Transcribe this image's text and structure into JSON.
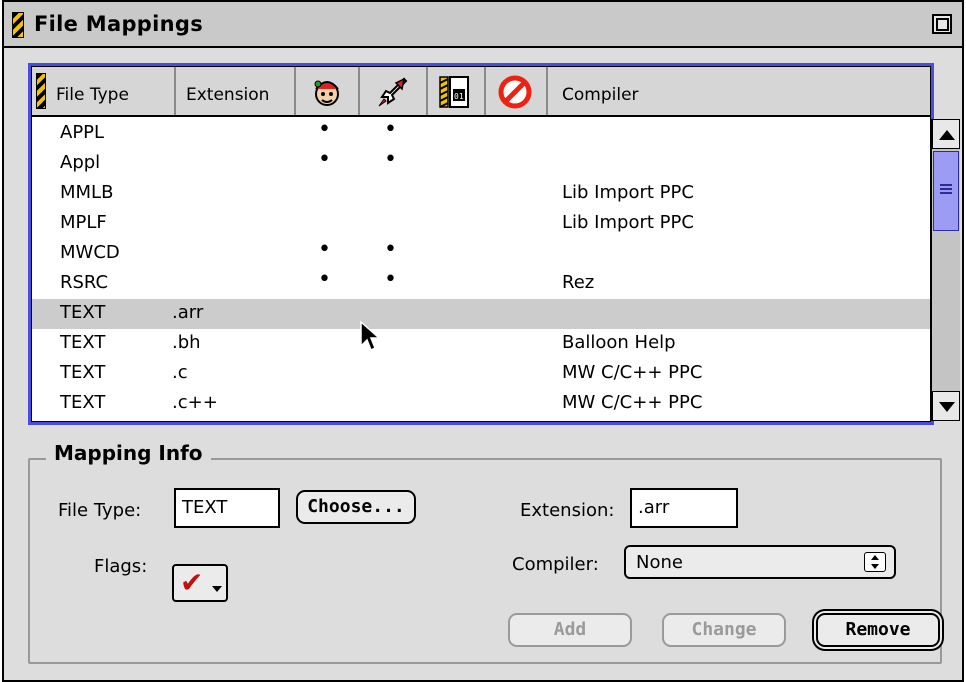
{
  "window": {
    "title": "File Mappings"
  },
  "table": {
    "columns": {
      "file_type": "File Type",
      "extension": "Extension",
      "flag1_icon": "resource-fork-icon",
      "flag2_icon": "launch-rocket-icon",
      "flag3_icon": "precompile-file-icon",
      "flag4_icon": "ignore-no-icon",
      "compiler": "Compiler"
    },
    "rows": [
      {
        "type": "APPL",
        "ext": "",
        "f1": "•",
        "f2": "•",
        "compiler": ""
      },
      {
        "type": "Appl",
        "ext": "",
        "f1": "•",
        "f2": "•",
        "compiler": ""
      },
      {
        "type": "MMLB",
        "ext": "",
        "f1": "",
        "f2": "",
        "compiler": "Lib Import PPC"
      },
      {
        "type": "MPLF",
        "ext": "",
        "f1": "",
        "f2": "",
        "compiler": "Lib Import PPC"
      },
      {
        "type": "MWCD",
        "ext": "",
        "f1": "•",
        "f2": "•",
        "compiler": ""
      },
      {
        "type": "RSRC",
        "ext": "",
        "f1": "•",
        "f2": "•",
        "compiler": "Rez"
      },
      {
        "type": "TEXT",
        "ext": ".arr",
        "f1": "",
        "f2": "",
        "compiler": "",
        "selected": true
      },
      {
        "type": "TEXT",
        "ext": ".bh",
        "f1": "",
        "f2": "",
        "compiler": "Balloon Help"
      },
      {
        "type": "TEXT",
        "ext": ".c",
        "f1": "",
        "f2": "",
        "compiler": "MW C/C++ PPC"
      },
      {
        "type": "TEXT",
        "ext": ".c++",
        "f1": "",
        "f2": "",
        "compiler": "MW C/C++ PPC"
      }
    ]
  },
  "mapping_info": {
    "title": "Mapping Info",
    "file_type_label": "File Type:",
    "file_type_value": "TEXT",
    "choose_label": "Choose...",
    "extension_label": "Extension:",
    "extension_value": ".arr",
    "flags_label": "Flags:",
    "flags_value": "✔",
    "compiler_label": "Compiler:",
    "compiler_value": "None",
    "add_label": "Add",
    "change_label": "Change",
    "remove_label": "Remove"
  },
  "colors": {
    "focus_ring": "#4a4de0",
    "scroll_thumb": "#9c9cf4",
    "selection": "#cccccc",
    "flags_check": "#c01010"
  }
}
